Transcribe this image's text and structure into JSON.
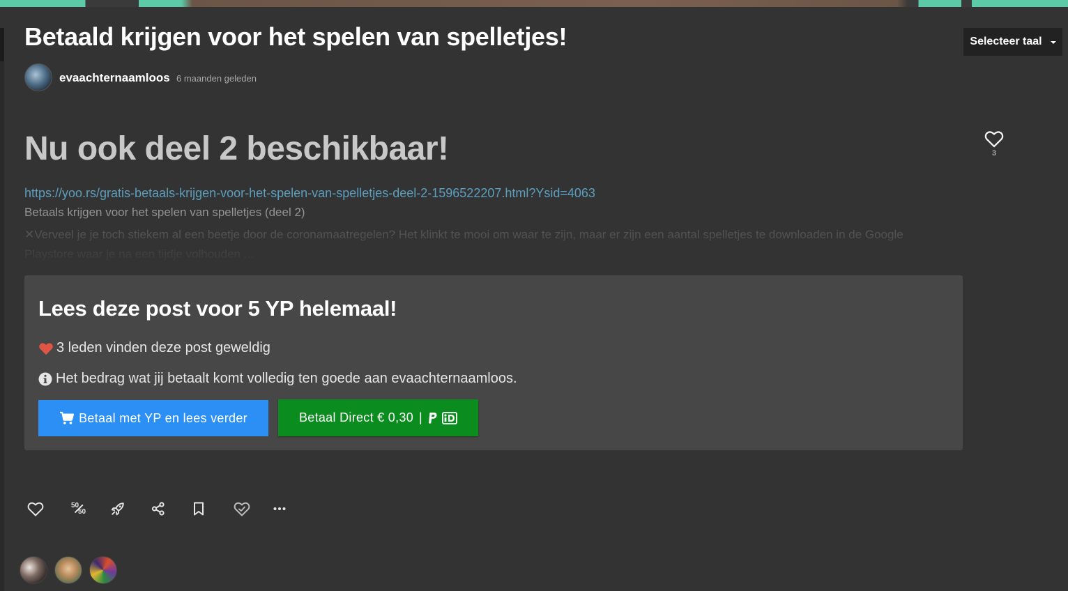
{
  "post": {
    "title": "Betaald krijgen voor het spelen van spelletjes!",
    "author": "evaachternaamloos",
    "time": "6 maanden geleden"
  },
  "language_selector": {
    "label": "Selecteer taal"
  },
  "content": {
    "heading": "Nu ook deel 2 beschikbaar!",
    "link": "https://yoo.rs/gratis-betaals-krijgen-voor-het-spelen-van-spelletjes-deel-2-1596522207.html?Ysid=4063",
    "subtitle": "Betaals krijgen voor het spelen van spelletjes (deel 2)",
    "excerpt_icon": "✕",
    "excerpt": "Verveel je je toch stiekem al een beetje door de coronamaatregelen? Het klinkt te mooi om waar te zijn, maar er zijn een aantal spelletjes te downloaden in de Google Playstore waar je na een tijdje volhouden ..."
  },
  "sidebar_like": {
    "count": "3",
    "icon": "heart-outline-icon"
  },
  "paywall": {
    "title": "Lees deze post voor 5 YP helemaal!",
    "likes_text": "3 leden vinden deze post geweldig",
    "info_text": "Het bedrag wat jij betaalt komt volledig ten goede aan evaachternaamloos.",
    "btn_yp_label": "Betaal met YP en lees verder",
    "btn_direct_label": "Betaal Direct € 0,30",
    "btn_direct_separator": "|",
    "colors": {
      "yp_button": "#2b8ff6",
      "direct_button": "#0b8c1e",
      "heart": "#e05545"
    }
  },
  "actions": [
    {
      "name": "like",
      "icon": "heart-icon"
    },
    {
      "name": "fifty-fifty",
      "icon": "fifty-fifty-icon",
      "label_top": "50",
      "label_bottom": "50"
    },
    {
      "name": "boost",
      "icon": "rocket-icon"
    },
    {
      "name": "share",
      "icon": "share-icon"
    },
    {
      "name": "bookmark",
      "icon": "bookmark-icon"
    },
    {
      "name": "favorite",
      "icon": "heart-check-icon"
    },
    {
      "name": "more",
      "icon": "more-icon"
    }
  ],
  "likers": [
    {
      "icon": "avatar-1"
    },
    {
      "icon": "avatar-2"
    },
    {
      "icon": "avatar-3"
    }
  ]
}
